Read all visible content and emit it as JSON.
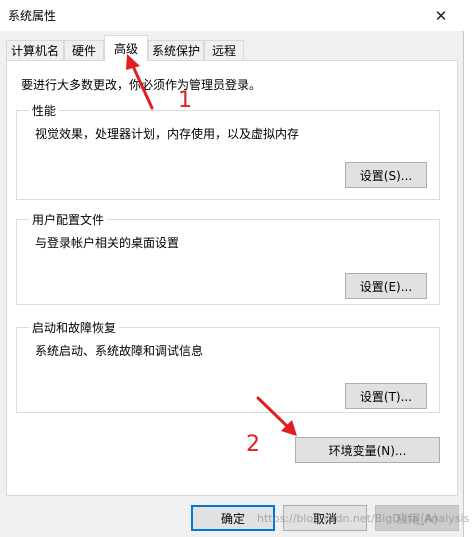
{
  "window": {
    "title": "系统属性",
    "close_icon": "close-icon"
  },
  "tabs": [
    {
      "label": "计算机名",
      "active": false
    },
    {
      "label": "硬件",
      "active": false
    },
    {
      "label": "高级",
      "active": true
    },
    {
      "label": "系统保护",
      "active": false
    },
    {
      "label": "远程",
      "active": false
    }
  ],
  "notice": "要进行大多数更改，你必须作为管理员登录。",
  "groups": {
    "performance": {
      "title": "性能",
      "desc": "视觉效果，处理器计划，内存使用，以及虚拟内存",
      "button": "设置(S)..."
    },
    "user_profiles": {
      "title": "用户配置文件",
      "desc": "与登录帐户相关的桌面设置",
      "button": "设置(E)..."
    },
    "startup_recovery": {
      "title": "启动和故障恢复",
      "desc": "系统启动、系统故障和调试信息",
      "button": "设置(T)..."
    }
  },
  "env_button": "环境变量(N)...",
  "footer": {
    "ok": "确定",
    "cancel": "取消",
    "apply": "应用(A)"
  },
  "annotations": {
    "one": "1",
    "two": "2",
    "color": "#e02020"
  },
  "watermark": "https://blog.csdn.net/BigData_Analysis"
}
